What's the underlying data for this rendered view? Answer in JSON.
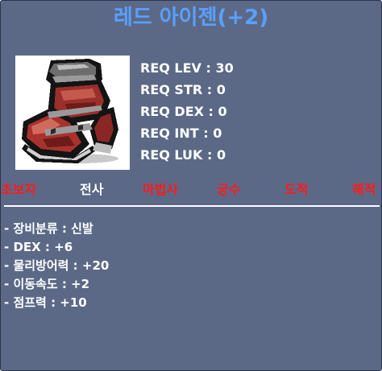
{
  "item": {
    "name": "레드 아이젠(+2)",
    "icon": "red-boots-icon"
  },
  "requirements": [
    {
      "label": "REQ LEV : 30"
    },
    {
      "label": "REQ STR : 0"
    },
    {
      "label": "REQ DEX : 0"
    },
    {
      "label": "REQ INT : 0"
    },
    {
      "label": "REQ LUK : 0"
    }
  ],
  "classes": [
    {
      "name": "초보자",
      "available": false
    },
    {
      "name": "전사",
      "available": true
    },
    {
      "name": "마법사",
      "available": false
    },
    {
      "name": "궁수",
      "available": false
    },
    {
      "name": "도적",
      "available": false
    },
    {
      "name": "해적",
      "available": false
    }
  ],
  "stats": [
    {
      "text": "- 장비분류 : 신발"
    },
    {
      "text": "- DEX : +6"
    },
    {
      "text": "- 물리방어력 : +20"
    },
    {
      "text": "- 이동속도 : +2"
    },
    {
      "text": "- 점프력 : +10"
    }
  ],
  "colors": {
    "background": "#5b6987",
    "title": "#5aa0ff",
    "available": "#ffffff",
    "unavailable": "#ff1a1a"
  }
}
